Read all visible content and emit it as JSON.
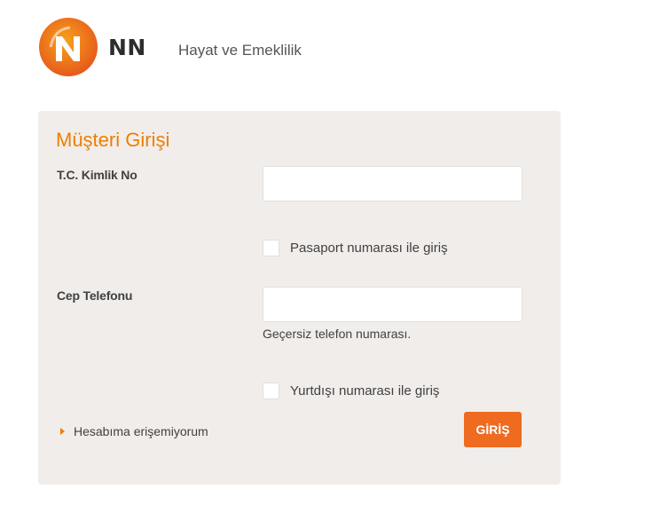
{
  "header": {
    "logo_icon": "nn-lion-logo-icon",
    "brand": "NN",
    "tagline": "Hayat ve Emeklilik"
  },
  "login": {
    "title": "Müşteri Girişi",
    "tc_label": "T.C. Kimlik No",
    "tc_value": "",
    "passport_checkbox_label": "Pasaport numarası ile giriş",
    "passport_checked": false,
    "phone_label": "Cep Telefonu",
    "phone_value": "",
    "phone_error": "Geçersiz telefon numarası.",
    "abroad_checkbox_label": "Yurtdışı numarası ile giriş",
    "abroad_checked": false,
    "forgot_link": "Hesabıma erişemiyorum",
    "submit_label": "GİRİŞ"
  },
  "colors": {
    "accent": "#ee7f00",
    "button": "#ee6b1f",
    "panel_bg": "#f1edeb"
  }
}
